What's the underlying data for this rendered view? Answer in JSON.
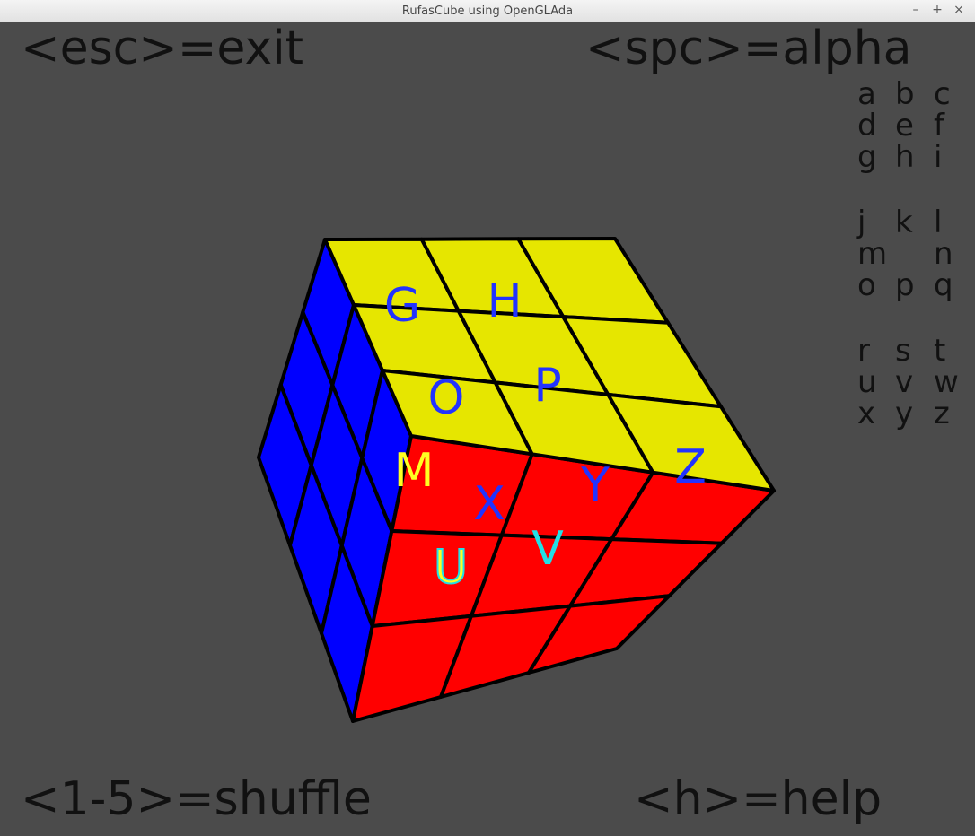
{
  "window": {
    "title": "RufasCube using OpenGLAda",
    "controls": {
      "minimize": "–",
      "maximize": "+",
      "close": "×"
    }
  },
  "hints": {
    "exit": "<esc>=exit",
    "alpha": "<spc>=alpha",
    "shuffle": "<1-5>=shuffle",
    "help": "<h>=help"
  },
  "legend": {
    "rows": [
      [
        "a",
        "b",
        "c"
      ],
      [
        "d",
        "e",
        "f"
      ],
      [
        "g",
        "h",
        "i"
      ],
      [
        "j",
        "k",
        "l"
      ],
      [
        "m",
        "",
        "n"
      ],
      [
        "o",
        "p",
        "q"
      ],
      [
        "r",
        "s",
        "t"
      ],
      [
        "u",
        "v",
        "w"
      ],
      [
        "x",
        "y",
        "z"
      ]
    ]
  },
  "cube": {
    "colors": {
      "top": "#e6e600",
      "left": "#0000ff",
      "front": "#ff0000",
      "grid": "#000000",
      "label_blue": "#2233ff",
      "label_yellow": "#ffff22",
      "label_cyan": "#22e0e6",
      "background": "#4b4b4b"
    },
    "labels": {
      "G": "G",
      "H": "H",
      "O": "O",
      "P": "P",
      "M": "M",
      "X": "X",
      "Y": "Y",
      "Z": "Z",
      "U": "U",
      "V": "V"
    }
  }
}
